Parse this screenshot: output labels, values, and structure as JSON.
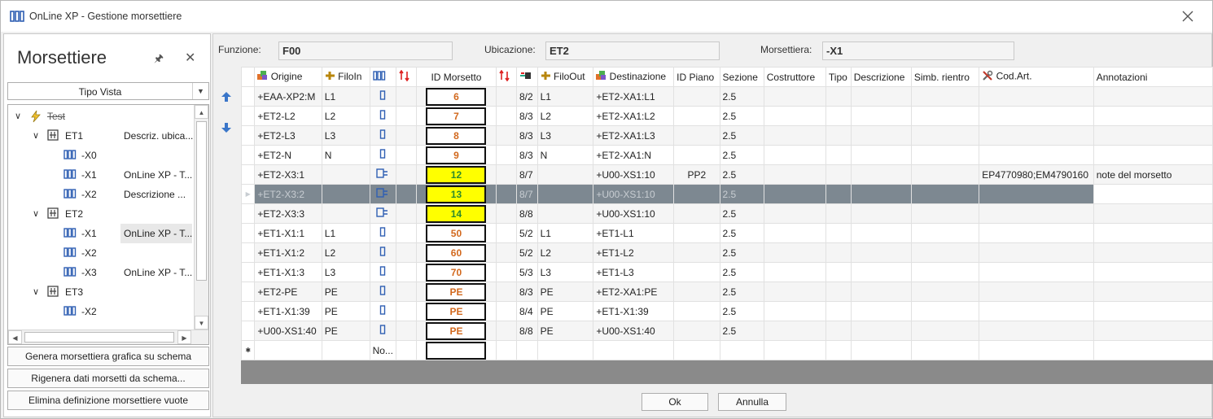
{
  "window": {
    "title": "OnLine XP - Gestione morsettiere"
  },
  "left": {
    "heading": "Morsettiere",
    "view_dropdown": "Tipo Vista",
    "tree": [
      {
        "label": "Test",
        "desc": "",
        "level": 0,
        "kind": "root"
      },
      {
        "label": "ET1",
        "desc": "Descriz. ubica...",
        "level": 1,
        "kind": "loc"
      },
      {
        "label": "-X0",
        "desc": "",
        "level": 2,
        "kind": "term"
      },
      {
        "label": "-X1",
        "desc": "OnLine XP - T...",
        "level": 2,
        "kind": "term"
      },
      {
        "label": "-X2",
        "desc": "Descrizione ...",
        "level": 2,
        "kind": "term"
      },
      {
        "label": "ET2",
        "desc": "",
        "level": 1,
        "kind": "loc"
      },
      {
        "label": "-X1",
        "desc": "OnLine XP - T...",
        "level": 2,
        "kind": "term",
        "selected": true
      },
      {
        "label": "-X2",
        "desc": "",
        "level": 2,
        "kind": "term"
      },
      {
        "label": "-X3",
        "desc": "OnLine XP - T...",
        "level": 2,
        "kind": "term"
      },
      {
        "label": "ET3",
        "desc": "",
        "level": 1,
        "kind": "loc"
      },
      {
        "label": "-X2",
        "desc": "",
        "level": 2,
        "kind": "term"
      }
    ],
    "buttons": {
      "generate": "Genera morsettiera grafica su schema",
      "regenerate": "Rigenera dati morsetti da schema...",
      "delete": "Elimina definizione morsettiere vuote"
    }
  },
  "filters": {
    "funzione_label": "Funzione:",
    "funzione_value": "F00",
    "ubicazione_label": "Ubicazione:",
    "ubicazione_value": "ET2",
    "morsettiera_label": "Morsettiera:",
    "morsettiera_value": "-X1"
  },
  "grid": {
    "columns": {
      "origine": "Origine",
      "filoin": "FiloIn",
      "id": "ID Morsetto",
      "filoout": "FiloOut",
      "destinazione": "Destinazione",
      "id_piano": "ID Piano",
      "sezione": "Sezione",
      "costruttore": "Costruttore",
      "tipo": "Tipo",
      "descrizione": "Descrizione",
      "simb": "Simb. rientro",
      "codart": "Cod.Art.",
      "annotazioni": "Annotazioni"
    },
    "rows": [
      {
        "origine": "+EAA-XP2:M",
        "filoin": "L1",
        "id": "6",
        "idstyle": "n",
        "pos": "8/2",
        "filoout": "L1",
        "dest": "+ET2-XA1:L1",
        "piano": "",
        "sez": "2.5",
        "cod": "",
        "ann": ""
      },
      {
        "origine": "+ET2-L2",
        "filoin": "L2",
        "id": "7",
        "idstyle": "n",
        "pos": "8/3",
        "filoout": "L2",
        "dest": "+ET2-XA1:L2",
        "piano": "",
        "sez": "2.5",
        "cod": "",
        "ann": ""
      },
      {
        "origine": "+ET2-L3",
        "filoin": "L3",
        "id": "8",
        "idstyle": "n",
        "pos": "8/3",
        "filoout": "L3",
        "dest": "+ET2-XA1:L3",
        "piano": "",
        "sez": "2.5",
        "cod": "",
        "ann": ""
      },
      {
        "origine": "+ET2-N",
        "filoin": "N",
        "id": "9",
        "idstyle": "n",
        "pos": "8/3",
        "filoout": "N",
        "dest": "+ET2-XA1:N",
        "piano": "",
        "sez": "2.5",
        "cod": "",
        "ann": ""
      },
      {
        "origine": "+ET2-X3:1",
        "filoin": "",
        "id": "12",
        "idstyle": "y",
        "pos": "8/7",
        "filoout": "",
        "dest": "+U00-XS1:10",
        "piano": "PP2",
        "sez": "2.5",
        "cod": "EP4770980;EM4790160",
        "ann": "note del morsetto"
      },
      {
        "origine": "+ET2-X3:2",
        "filoin": "",
        "id": "13",
        "idstyle": "y",
        "pos": "8/7",
        "filoout": "",
        "dest": "+U00-XS1:10",
        "piano": "",
        "sez": "2.5",
        "cod": "",
        "ann": "",
        "selected": true
      },
      {
        "origine": "+ET2-X3:3",
        "filoin": "",
        "id": "14",
        "idstyle": "y",
        "pos": "8/8",
        "filoout": "",
        "dest": "+U00-XS1:10",
        "piano": "",
        "sez": "2.5",
        "cod": "",
        "ann": ""
      },
      {
        "origine": "+ET1-X1:1",
        "filoin": "L1",
        "id": "50",
        "idstyle": "n",
        "pos": "5/2",
        "filoout": "L1",
        "dest": "+ET1-L1",
        "piano": "",
        "sez": "2.5",
        "cod": "",
        "ann": ""
      },
      {
        "origine": "+ET1-X1:2",
        "filoin": "L2",
        "id": "60",
        "idstyle": "n",
        "pos": "5/2",
        "filoout": "L2",
        "dest": "+ET1-L2",
        "piano": "",
        "sez": "2.5",
        "cod": "",
        "ann": ""
      },
      {
        "origine": "+ET1-X1:3",
        "filoin": "L3",
        "id": "70",
        "idstyle": "n",
        "pos": "5/3",
        "filoout": "L3",
        "dest": "+ET1-L3",
        "piano": "",
        "sez": "2.5",
        "cod": "",
        "ann": ""
      },
      {
        "origine": "+ET2-PE",
        "filoin": "PE",
        "id": "PE",
        "idstyle": "n",
        "pos": "8/3",
        "filoout": "PE",
        "dest": "+ET2-XA1:PE",
        "piano": "",
        "sez": "2.5",
        "cod": "",
        "ann": ""
      },
      {
        "origine": "+ET1-X1:39",
        "filoin": "PE",
        "id": "PE",
        "idstyle": "n",
        "pos": "8/4",
        "filoout": "PE",
        "dest": "+ET1-X1:39",
        "piano": "",
        "sez": "2.5",
        "cod": "",
        "ann": ""
      },
      {
        "origine": "+U00-XS1:40",
        "filoin": "PE",
        "id": "PE",
        "idstyle": "n",
        "pos": "8/8",
        "filoout": "PE",
        "dest": "+U00-XS1:40",
        "piano": "",
        "sez": "2.5",
        "cod": "",
        "ann": ""
      }
    ],
    "new_row_text": "No..."
  },
  "footer": {
    "ok": "Ok",
    "cancel": "Annulla"
  }
}
